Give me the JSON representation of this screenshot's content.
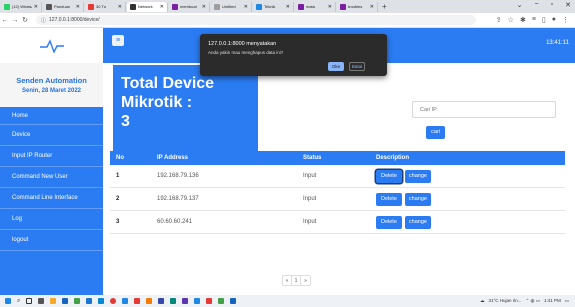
{
  "browser": {
    "tabs": [
      {
        "label": "(12) WhatsApp",
        "color": "#25d366"
      },
      {
        "label": "Panduan",
        "color": "#555555"
      },
      {
        "label": "30 Tu",
        "color": "#e53935"
      },
      {
        "label": "Network",
        "color": "#333333",
        "active": true
      },
      {
        "label": "membuat",
        "color": "#7b1fa2"
      },
      {
        "label": "Untitled",
        "color": "#9e9e9e"
      },
      {
        "label": "Teknik",
        "color": "#1e88e5"
      },
      {
        "label": "mata",
        "color": "#7b1fa2"
      },
      {
        "label": "troubles",
        "color": "#7b1fa2"
      }
    ],
    "url": "127.0.0.1:8000/device/"
  },
  "sidebar": {
    "title": "Senden Automation",
    "date": "Senin, 28 Maret 2022",
    "items": [
      "Home",
      "Device",
      "Input IP Router",
      "Command New User",
      "Command Line Interface",
      "Log",
      "logout"
    ]
  },
  "topbar": {
    "time": "13:41:11"
  },
  "main": {
    "heading": [
      "Total Device",
      "Mikrotik :",
      "3"
    ],
    "search_placeholder": "Cari IP",
    "search_button": "cari"
  },
  "table": {
    "headers": [
      "No",
      "IP Address",
      "Status",
      "Description"
    ],
    "rows": [
      {
        "no": "1",
        "ip": "192.168.79.136",
        "status": "Input"
      },
      {
        "no": "2",
        "ip": "192.168.79.137",
        "status": "Input"
      },
      {
        "no": "3",
        "ip": "60.60.60.241",
        "status": "Input"
      }
    ],
    "delete_label": "Delete",
    "change_label": "change"
  },
  "pagination": [
    "«",
    "1",
    "»"
  ],
  "dialog": {
    "title": "127.0.0.1:8000 menyatakan",
    "message": "Anda yakin mau menghapus data ini?",
    "ok": "Oke",
    "cancel": "Batal"
  },
  "taskbar": {
    "tray": "31°C Hujan rin...",
    "clock": "1:41 PM"
  },
  "colors": {
    "accent": "#2b7cf2",
    "dialog_bg": "#2b2b2b",
    "dialog_button": "#8ab4f8"
  }
}
